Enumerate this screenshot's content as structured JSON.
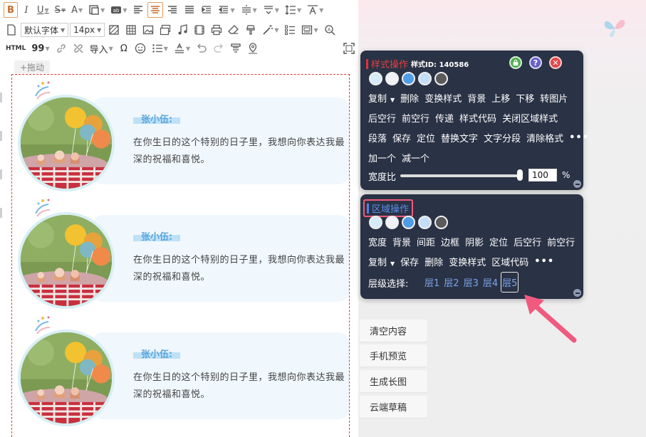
{
  "toolbar": {
    "font_family": "默认字体",
    "font_size": "14px",
    "import_label": "导入",
    "html_label": "HTML",
    "quote_label": "99"
  },
  "drag_handle": "+拖动",
  "cards": [
    {
      "name": "张小伍:",
      "text": "在你生日的这个特别的日子里，我想向你表达我最深的祝福和喜悦。"
    },
    {
      "name": "张小伍:",
      "text": "在你生日的这个特别的日子里，我想向你表达我最深的祝福和喜悦。"
    },
    {
      "name": "张小伍:",
      "text": "在你生日的这个特别的日子里，我想向你表达我最深的祝福和喜悦。"
    }
  ],
  "style_panel": {
    "title": "样式操作",
    "style_id": "样式ID: 140586",
    "swatch_colors": [
      "#d4ecf7",
      "#f0f2f5",
      "#4f9de6",
      "#c3def7",
      "#5a5a5a"
    ],
    "row1": [
      "复制",
      "删除",
      "变换样式",
      "背景",
      "上移",
      "下移",
      "转图片"
    ],
    "row2": [
      "后空行",
      "前空行",
      "传递",
      "样式代码",
      "关闭区域样式"
    ],
    "row3": [
      "段落",
      "保存",
      "定位",
      "替换文字",
      "文字分段",
      "清除格式"
    ],
    "row4": [
      "加一个",
      "减一个"
    ],
    "ratio_label": "宽度比",
    "ratio_value": "100",
    "ratio_fraction": 1.0,
    "ratio_unit": "%"
  },
  "area_panel": {
    "title": "区域操作",
    "swatch_colors": [
      "#d4ecf7",
      "#f0f2f5",
      "#4f9de6",
      "#c3def7",
      "#5a5a5a"
    ],
    "row1": [
      "宽度",
      "背景",
      "间距",
      "边框",
      "阴影",
      "定位",
      "后空行",
      "前空行"
    ],
    "row2": [
      "复制",
      "保存",
      "删除",
      "变换样式",
      "区域代码"
    ],
    "level_label": "层级选择:",
    "levels": [
      "层1",
      "层2",
      "层3",
      "层4",
      "层5"
    ],
    "active_level": "层5"
  },
  "side_buttons": [
    "清空内容",
    "手机预览",
    "生成长图",
    "云端草稿"
  ],
  "colors": {
    "panel_bg": "#2a3245",
    "accent_red": "#e0303a",
    "accent_blue": "#5b8fe8",
    "name_blue": "#5aa5da",
    "arrow_pink": "#f05a7e"
  }
}
